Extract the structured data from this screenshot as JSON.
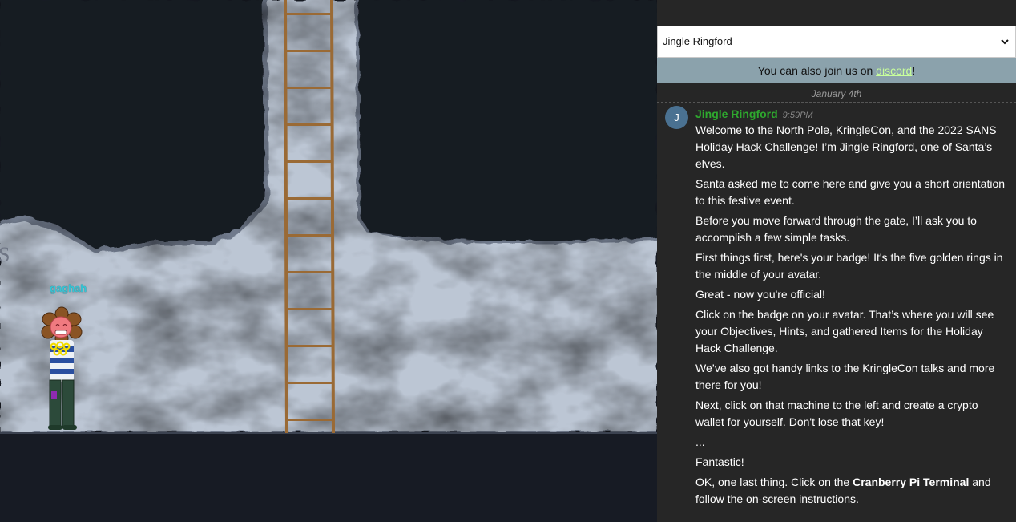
{
  "game": {
    "player_name": "gaghah",
    "edge_letter": "S"
  },
  "chat": {
    "npc_select": "Jingle Ringford",
    "discord_prefix": "You can also join us on ",
    "discord_link": "discord",
    "discord_suffix": "!",
    "date": "January 4th",
    "message": {
      "avatar_initial": "J",
      "author": "Jingle Ringford",
      "time": "9:59PM",
      "lines": [
        "Welcome to the North Pole, KringleCon, and the 2022 SANS Holiday Hack Challenge! I’m Jingle Ringford, one of Santa’s elves.",
        "Santa asked me to come here and give you a short orientation to this festive event.",
        "Before you move forward through the gate, I’ll ask you to accomplish a few simple tasks.",
        "First things first, here's your badge! It's the five golden rings in the middle of your avatar.",
        "Great - now you're official!",
        "Click on the badge on your avatar. That’s where you will see your Objectives, Hints, and gathered Items for the Holiday Hack Challenge.",
        "We’ve also got handy links to the KringleCon talks and more there for you!",
        "Next, click on that machine to the left and create a crypto wallet for yourself. Don't lose that key!",
        "..."
      ],
      "line_fantastic": "Fantastic!",
      "last_prefix": "OK, one last thing. Click on the ",
      "last_bold": "Cranberry Pi Terminal",
      "last_suffix": " and follow the on-screen instructions."
    }
  },
  "colors": {
    "snow": "#bcc6d4",
    "dark": "#171b24",
    "ladder": "#9a6a35",
    "author": "#2ea82e",
    "discord_bar": "#8ba2ac"
  }
}
